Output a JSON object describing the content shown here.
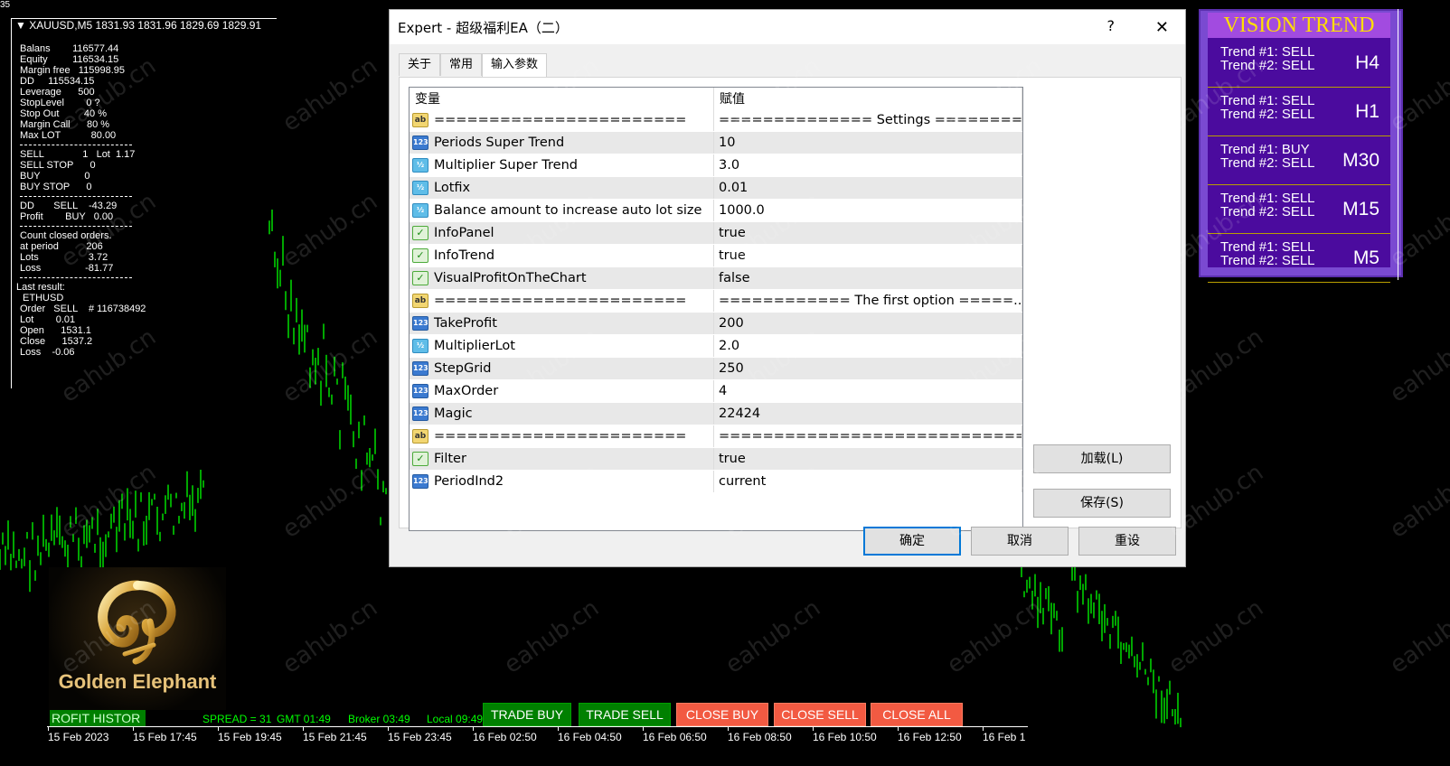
{
  "corner_label": "35",
  "chart_header": "▼ XAUUSD,M5  1831.93 1831.96 1829.69 1829.91",
  "info_panel": {
    "rows_a": [
      "Balans        116577.44",
      "Equity         116534.15",
      "Margin free   115998.95",
      "DD     115534.15",
      "Leverage      500",
      "StopLevel        0 ?",
      "Stop Out         40 %",
      "Margin Call      80 %",
      "Max LOT           80.00"
    ],
    "rows_b": [
      "SELL              1   Lot  1.17",
      "SELL STOP      0",
      "BUY                0",
      "BUY STOP      0"
    ],
    "rows_c": [
      "DD       SELL    -43.29",
      "Profit        BUY   0.00"
    ],
    "rows_d": [
      "Count closed orders.",
      "at period          206",
      "Lots                  3.72",
      "Loss                -81.77"
    ],
    "rows_e": [
      " ETHUSD",
      "Order   SELL    # 116738492",
      "Lot        0.01",
      "Open      1531.1",
      "Close      1537.2",
      "Loss    -0.06"
    ],
    "last_result_label": "Last result:"
  },
  "dialog": {
    "title": "Expert - 超级福利EA（二）",
    "help": "?",
    "close": "✕",
    "tabs": [
      {
        "label": "关于",
        "active": false
      },
      {
        "label": "常用",
        "active": false
      },
      {
        "label": "输入参数",
        "active": true
      }
    ],
    "col_variable": "变量",
    "col_value": "赋值",
    "params": [
      {
        "icon": "ab",
        "name": "=======================",
        "value": "============== Settings ========..."
      },
      {
        "icon": "123",
        "name": "Periods Super Trend",
        "value": "10"
      },
      {
        "icon": "half",
        "name": "Multiplier Super Trend",
        "value": "3.0"
      },
      {
        "icon": "half",
        "name": "Lotfix",
        "value": "0.01"
      },
      {
        "icon": "half",
        "name": "Balance amount to increase auto lot size",
        "value": "1000.0"
      },
      {
        "icon": "bool",
        "name": "InfoPanel",
        "value": "true"
      },
      {
        "icon": "bool",
        "name": "InfoTrend",
        "value": "true"
      },
      {
        "icon": "bool",
        "name": "VisualProfitOnTheChart",
        "value": "false"
      },
      {
        "icon": "ab",
        "name": "=======================",
        "value": "============ The first option =====..."
      },
      {
        "icon": "123",
        "name": "TakeProfit",
        "value": "200"
      },
      {
        "icon": "half",
        "name": "MultiplierLot",
        "value": "2.0"
      },
      {
        "icon": "123",
        "name": "StepGrid",
        "value": "250"
      },
      {
        "icon": "123",
        "name": "MaxOrder",
        "value": "4"
      },
      {
        "icon": "123",
        "name": "Magic",
        "value": "22424"
      },
      {
        "icon": "ab",
        "name": "=======================",
        "value": "=============================..."
      },
      {
        "icon": "bool",
        "name": "Filter",
        "value": "true"
      },
      {
        "icon": "123",
        "name": "PeriodInd2",
        "value": "current"
      }
    ],
    "load_button": "加载(L)",
    "save_button": "保存(S)",
    "ok_button": "确定",
    "cancel_button": "取消",
    "reset_button": "重设"
  },
  "vision_trend": {
    "title": "VISION TREND",
    "items": [
      {
        "t1": "Trend #1: SELL",
        "t2": "Trend #2: SELL",
        "tf": "H4"
      },
      {
        "t1": "Trend #1: SELL",
        "t2": "Trend #2: SELL",
        "tf": "H1"
      },
      {
        "t1": "Trend #1: BUY",
        "t2": "Trend #2: SELL",
        "tf": "M30"
      },
      {
        "t1": "Trend #1: SELL",
        "t2": "Trend #2: SELL",
        "tf": "M15"
      },
      {
        "t1": "Trend #1: SELL",
        "t2": "Trend #2: SELL",
        "tf": "M5"
      }
    ],
    "bg_color": "#4b0b9e",
    "title_color": "#ffde00"
  },
  "logo": {
    "name": "Golden Elephant"
  },
  "bottom": {
    "profit_history": "ROFIT HISTOR",
    "spread": "SPREAD = 31",
    "gmt": "GMT 01:49",
    "broker": "Broker 03:49",
    "local": "Local 09:49",
    "trade_buy": "TRADE BUY",
    "trade_sell": "TRADE SELL",
    "close_buy": "CLOSE BUY",
    "close_sell": "CLOSE SELL",
    "close_all": "CLOSE ALL"
  },
  "time_axis": [
    "15 Feb 2023",
    "15 Feb 17:45",
    "15 Feb 19:45",
    "15 Feb 21:45",
    "15 Feb 23:45",
    "16 Feb 02:50",
    "16 Feb 04:50",
    "16 Feb 06:50",
    "16 Feb 08:50",
    "16 Feb 10:50",
    "16 Feb 12:50",
    "16 Feb 1"
  ],
  "watermark": "eahub.cn",
  "colors": {
    "bull": "#00ff00",
    "background": "#000000",
    "close_button": "#f25a42",
    "trade_button": "#008000"
  }
}
